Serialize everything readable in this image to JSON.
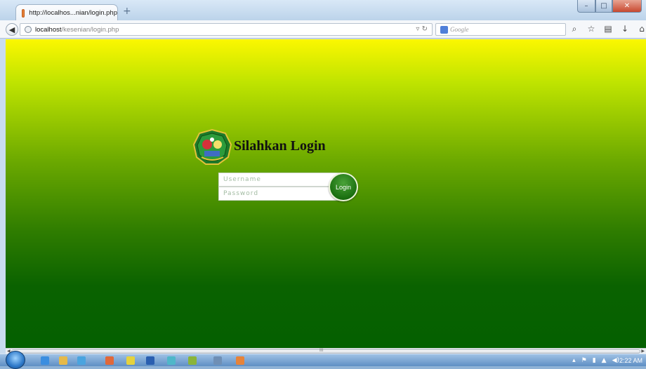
{
  "browser": {
    "tab_title": "http://localhos...nian/login.php",
    "new_tab_symbol": "+",
    "url_host": "localhost",
    "url_path": "/kesenian/login.php",
    "search_placeholder": "Google"
  },
  "page": {
    "heading": "Silahkan Login",
    "username_placeholder": "Username",
    "password_placeholder": "Password",
    "login_label": "Login",
    "colors": {
      "top": "#fbf700",
      "bottom": "#046000",
      "button": "#1a6f10"
    }
  },
  "scrollbar": {
    "grip": "III"
  },
  "taskbar": {
    "clock": "2:22 AM"
  }
}
